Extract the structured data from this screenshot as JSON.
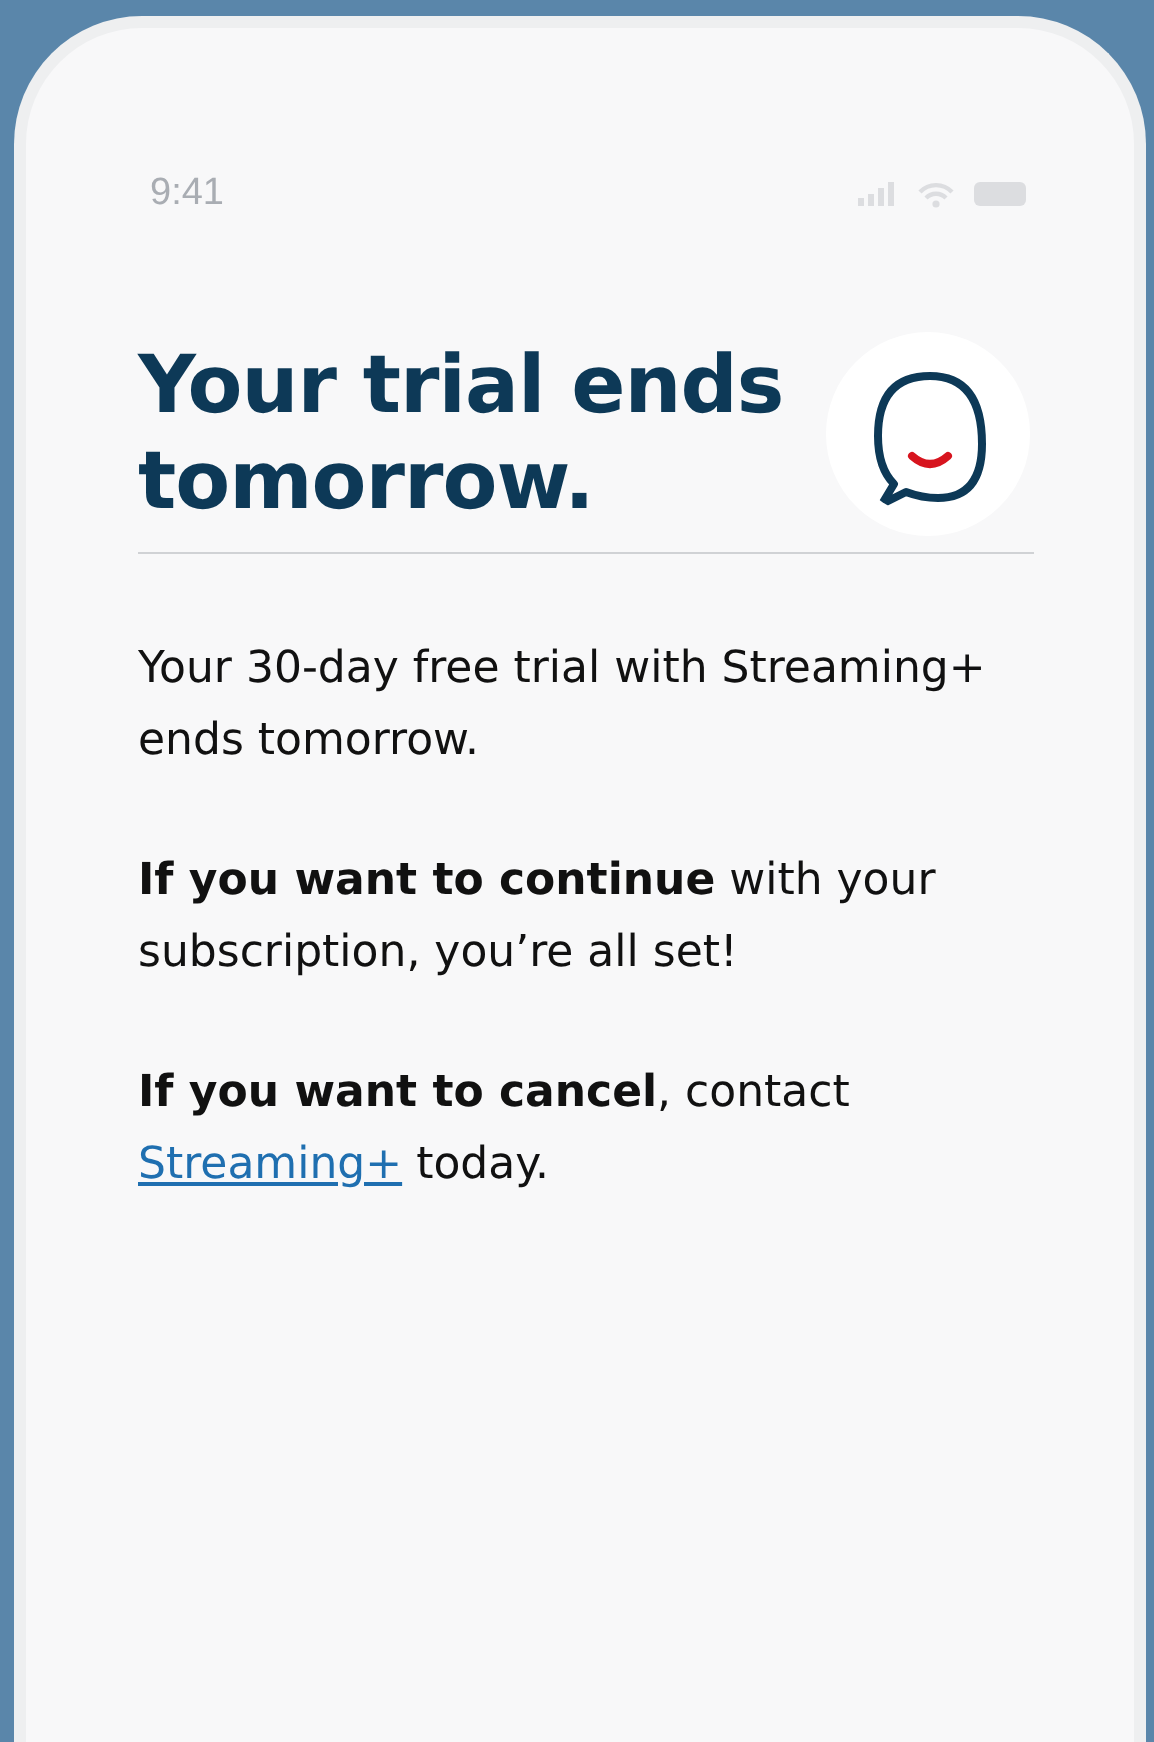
{
  "status_bar": {
    "time": "9:41"
  },
  "header": {
    "title": "Your trial ends tomorrow."
  },
  "paragraphs": [
    {
      "kind": "plain",
      "text": "Your 30-day free trial with Streaming+ ends tomorrow."
    },
    {
      "kind": "plain",
      "text": "**If you want to continue** with your subscription, you’re all set!"
    },
    {
      "kind": "link",
      "before": "**If you want to cancel**, contact",
      "link": "Streaming+",
      "after": "today."
    }
  ]
}
